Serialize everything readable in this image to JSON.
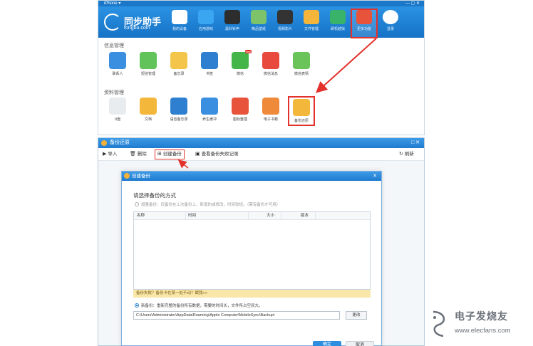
{
  "app": {
    "title_bar": "iPhone ▾",
    "logo_name": "同步助手",
    "logo_url": "tongbu.com",
    "nav": [
      {
        "label": "我的设备",
        "icon": "store-icon",
        "color": "#ffffff"
      },
      {
        "label": "应用游戏",
        "icon": "app-store-icon",
        "color": "#3aa6f2"
      },
      {
        "label": "黑科铃声",
        "icon": "music-icon",
        "color": "#2d2d2d"
      },
      {
        "label": "精品壁纸",
        "icon": "wallpaper-icon",
        "color": "#7cc36a"
      },
      {
        "label": "视频影片",
        "icon": "film-icon",
        "color": "#333333"
      },
      {
        "label": "文件管理",
        "icon": "folder-icon",
        "color": "#f5b53b"
      },
      {
        "label": "刷机越狱",
        "icon": "refresh-icon",
        "color": "#39b26a"
      },
      {
        "label": "更多功能",
        "icon": "more-features-icon",
        "color": "#e8543b",
        "selected": true
      },
      {
        "label": "登录",
        "icon": "user-icon",
        "color": "#ffffff"
      }
    ],
    "section_info": "信息管理",
    "section_data": "资料管理",
    "info_tiles": [
      {
        "label": "联系人",
        "icon": "contacts-icon",
        "color": "#3a8fe0"
      },
      {
        "label": "短信管理",
        "icon": "sms-icon",
        "color": "#62c35a"
      },
      {
        "label": "备忘录",
        "icon": "notes-icon",
        "color": "#f3c64b"
      },
      {
        "label": "书签",
        "icon": "bookmark-icon",
        "color": "#2f7fd0"
      },
      {
        "label": "微信",
        "icon": "wechat-icon",
        "color": "#44b549",
        "badge": "new"
      },
      {
        "label": "微信消息",
        "icon": "wechat-backup-icon",
        "color": "#e84a3e"
      },
      {
        "label": "微信表情",
        "icon": "smile-icon",
        "color": "#6ac45a"
      }
    ],
    "data_tiles": [
      {
        "label": "U盘",
        "icon": "usb-icon",
        "color": "#e8ecef"
      },
      {
        "label": "文档",
        "icon": "document-icon",
        "color": "#f3b83b"
      },
      {
        "label": "语音备忘录",
        "icon": "microphone-icon",
        "color": "#2f7fd0"
      },
      {
        "label": "养生缓冲",
        "icon": "clock-icon",
        "color": "#3a8fe0"
      },
      {
        "label": "图标整理",
        "icon": "grid-icon",
        "color": "#e8543b"
      },
      {
        "label": "电子书籍",
        "icon": "book-icon",
        "color": "#f08a3b"
      },
      {
        "label": "备份还原",
        "icon": "backup-restore-icon",
        "color": "#f3b83b",
        "selected": true
      }
    ]
  },
  "backup_window": {
    "title": "备份还原",
    "toolbar": {
      "import": "导入",
      "delete": "删除",
      "create_backup": "创建备份",
      "view_failed": "查看备份失败记录",
      "refresh": "刷新"
    }
  },
  "dialog": {
    "title": "创建备份",
    "heading": "请选择备份的方式",
    "option_incremental": "增量备份：仅备份在上次备份上，新增的或修改，时间较短。（需有备份才可用）",
    "table_columns": [
      "名称",
      "时间",
      "大小",
      "版本"
    ],
    "warning": "备份失败？备份卡在某一处不动？戳我>>",
    "option_new": "新备份：重新完整的备份所有数据，需要的时间长，文件所占空间大。",
    "path": "C:\\Users\\Administrator\\AppData\\Roaming\\Apple Computer\\MobileSync\\Backup\\",
    "change_button": "更改",
    "ok_button": "确定",
    "cancel_button": "取消"
  },
  "watermark": {
    "brand": "电子发烧友",
    "url": "www.elecfans.com"
  },
  "colors": {
    "brand_blue": "#1f7bcf",
    "highlight_red": "#e2322b",
    "warning_bg": "#f8e7a8"
  }
}
